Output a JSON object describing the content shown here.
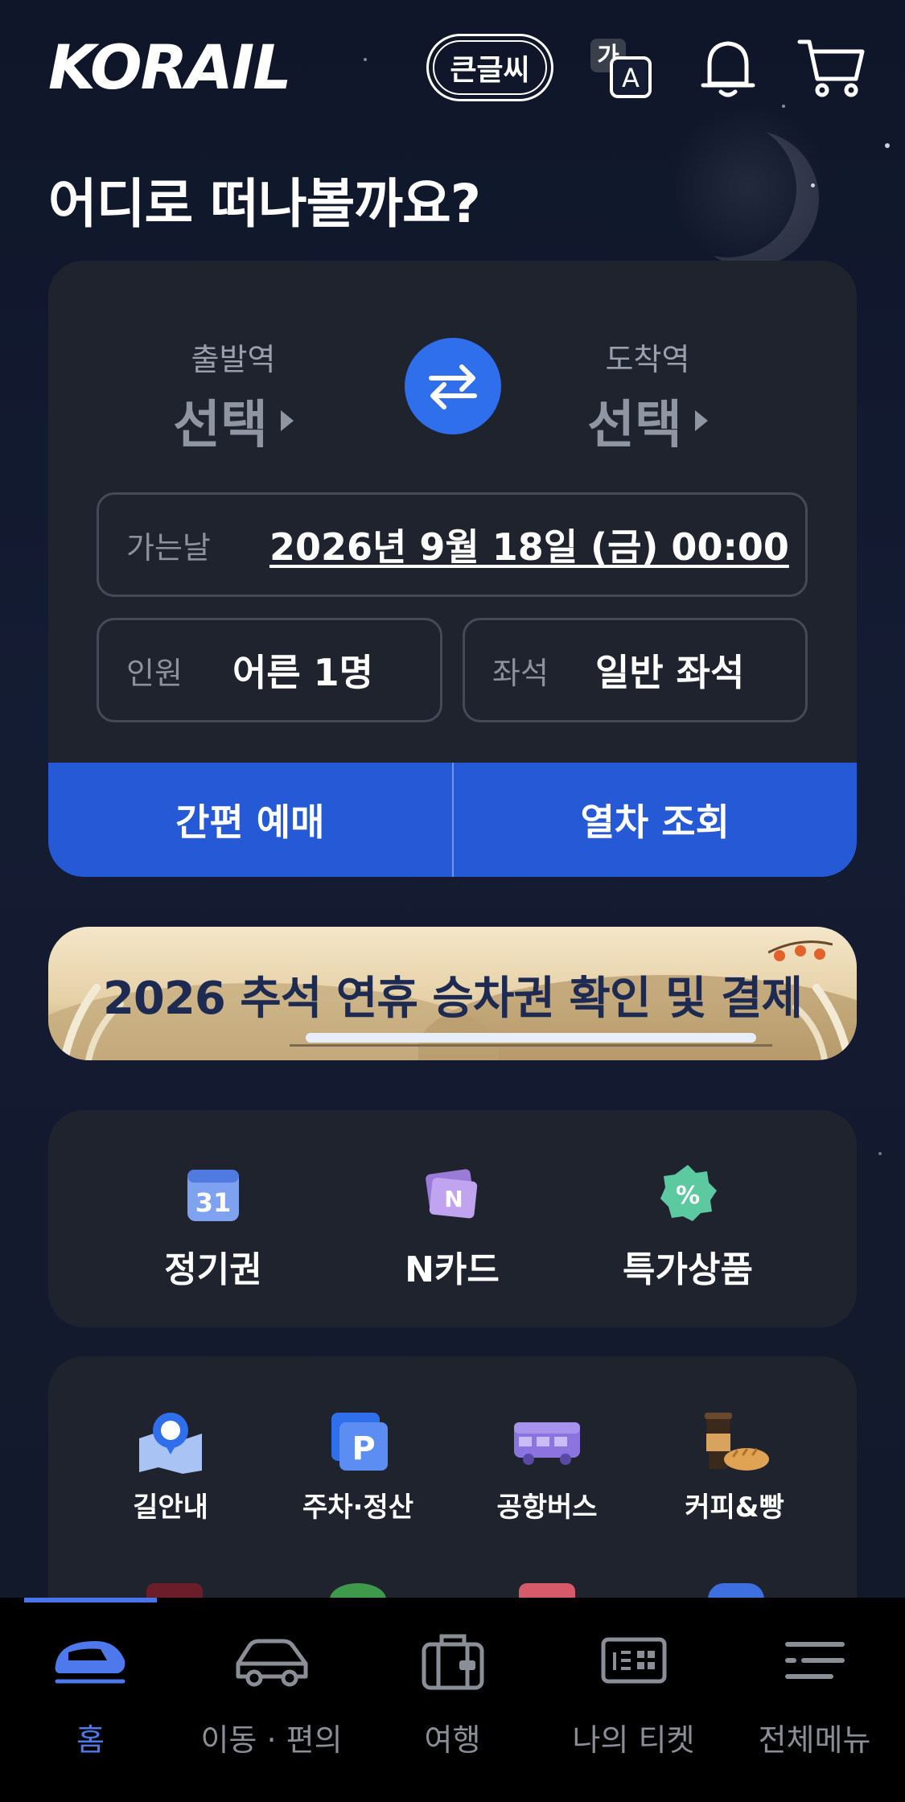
{
  "app": {
    "logo_text": "KORAIL"
  },
  "header": {
    "big_font_label": "큰글씨",
    "translate_glyph_top": "가",
    "translate_glyph_bottom": "A"
  },
  "headline": "어디로 떠나볼까요?",
  "booking": {
    "departure": {
      "label": "출발역",
      "value": "선택"
    },
    "arrival": {
      "label": "도착역",
      "value": "선택"
    },
    "date": {
      "label": "가는날",
      "value": "2026년 9월 18일 (금) 00:00"
    },
    "passengers": {
      "label": "인원",
      "value": "어른 1명"
    },
    "seat": {
      "label": "좌석",
      "value": "일반 좌석"
    },
    "quick_book_label": "간편 예매",
    "search_trains_label": "열차 조회"
  },
  "banner": {
    "title": "2026 추석 연휴 승차권 확인 및 결제"
  },
  "quick_menu": {
    "items": [
      {
        "label": "정기권",
        "icon": "calendar-icon",
        "icon_text": "31"
      },
      {
        "label": "N카드",
        "icon": "n-card-icon",
        "icon_text": "N"
      },
      {
        "label": "특가상품",
        "icon": "discount-badge-icon",
        "icon_text": "%"
      }
    ]
  },
  "services": {
    "items": [
      {
        "label": "길안내",
        "icon": "map-directions-icon"
      },
      {
        "label": "주차·정산",
        "icon": "parking-icon",
        "icon_text": "P"
      },
      {
        "label": "공항버스",
        "icon": "bus-icon"
      },
      {
        "label": "커피&빵",
        "icon": "coffee-bread-icon"
      }
    ]
  },
  "bottom_nav": {
    "items": [
      {
        "label": "홈",
        "icon": "train-icon",
        "active": true
      },
      {
        "label": "이동 · 편의",
        "icon": "car-icon",
        "active": false
      },
      {
        "label": "여행",
        "icon": "suitcase-icon",
        "active": false
      },
      {
        "label": "나의 티켓",
        "icon": "ticket-icon",
        "active": false
      },
      {
        "label": "전체메뉴",
        "icon": "menu-icon",
        "active": false
      }
    ]
  },
  "colors": {
    "accent_blue": "#2f6fec",
    "action_blue": "#2559d6",
    "card_bg": "#1f232e",
    "nav_active": "#4d79ec"
  }
}
